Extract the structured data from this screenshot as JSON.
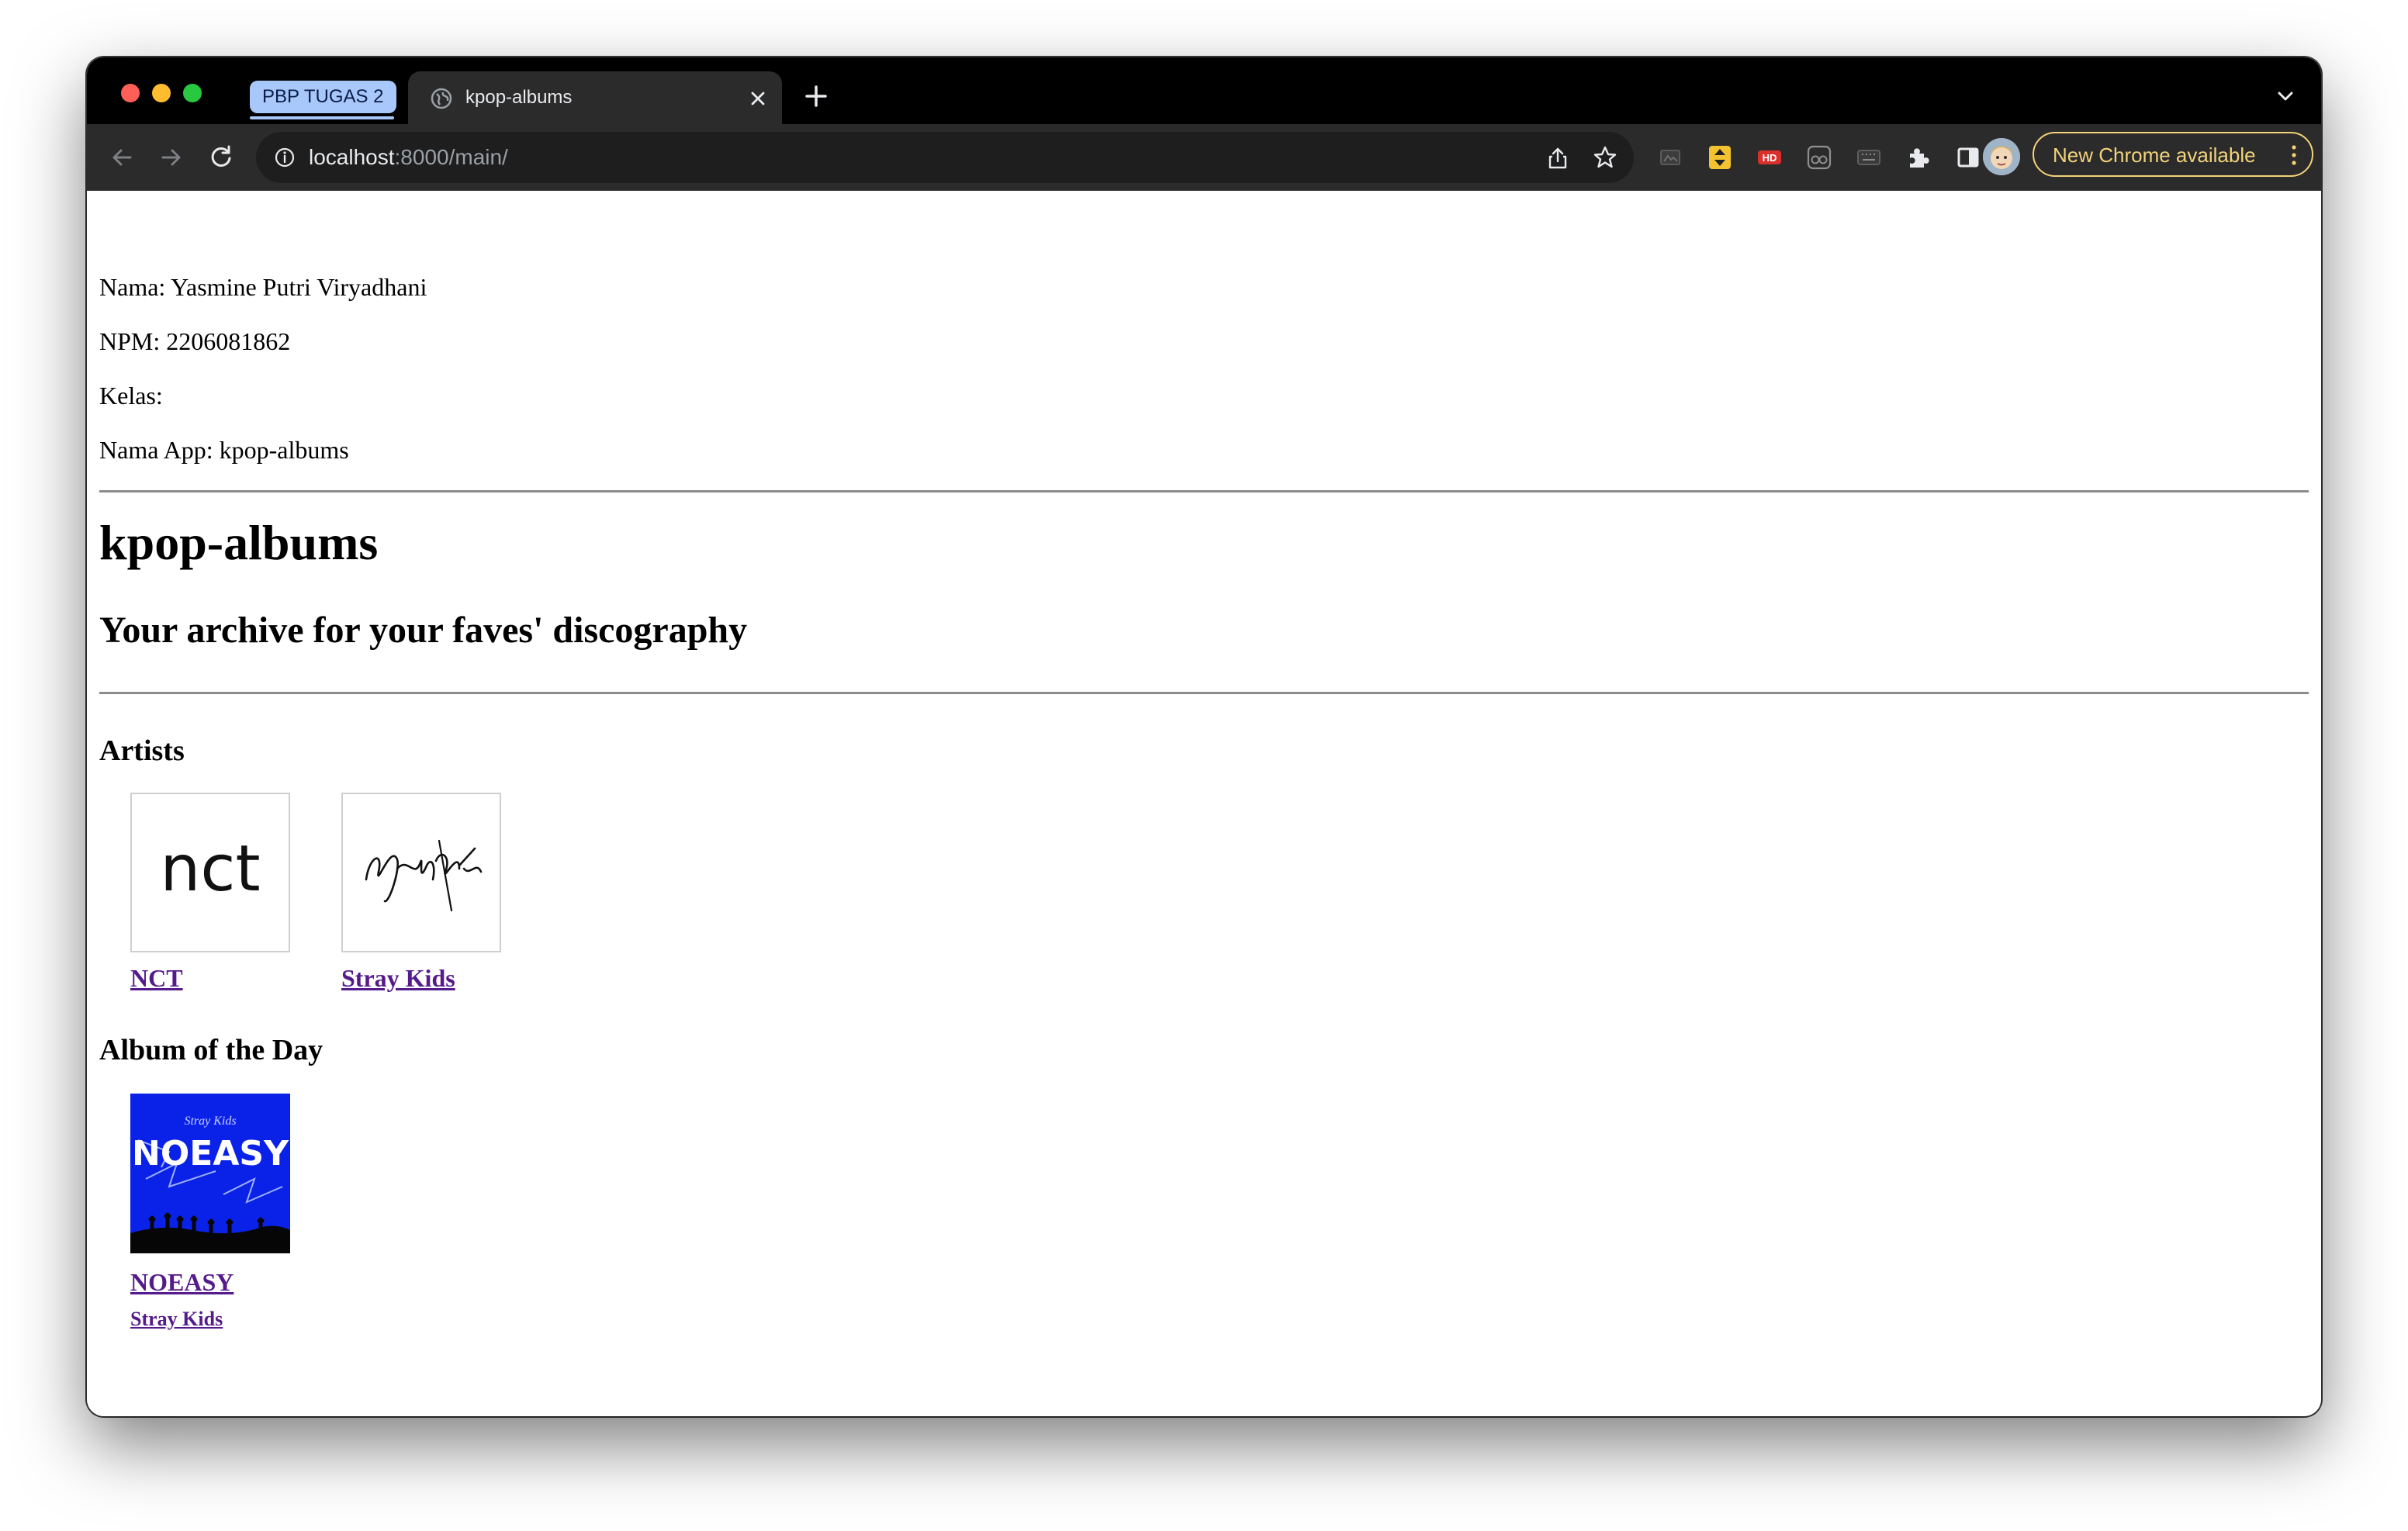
{
  "browser": {
    "tab_group_label": "PBP TUGAS 2",
    "active_tab_title": "kpop-albums",
    "url_host": "localhost",
    "url_path": ":8000/main/",
    "update_label": "New Chrome available",
    "extensions": [
      "image-extension-icon",
      "sort-extension-icon",
      "hd-extension-icon",
      "glasses-extension-icon",
      "keyboard-extension-icon",
      "puzzle-icon",
      "sidepanel-icon"
    ],
    "hd_badge": "HD"
  },
  "page": {
    "info": {
      "nama": "Nama: Yasmine Putri Viryadhani",
      "npm": "NPM: 2206081862",
      "kelas": "Kelas:",
      "app": "Nama App: kpop-albums"
    },
    "title": "kpop-albums",
    "subtitle": "Your archive for your faves' discography",
    "artists_heading": "Artists",
    "artists": [
      {
        "name": "NCT",
        "logo_text": "nct"
      },
      {
        "name": "Stray Kids",
        "logo_text": "Stray Kids"
      }
    ],
    "album_heading": "Album of the Day",
    "album": {
      "title": "NOEASY",
      "artist": "Stray Kids",
      "cover_text": "NOEASY",
      "cover_small_text": "Stray Kids",
      "cover_color": "#0a22e8"
    }
  }
}
